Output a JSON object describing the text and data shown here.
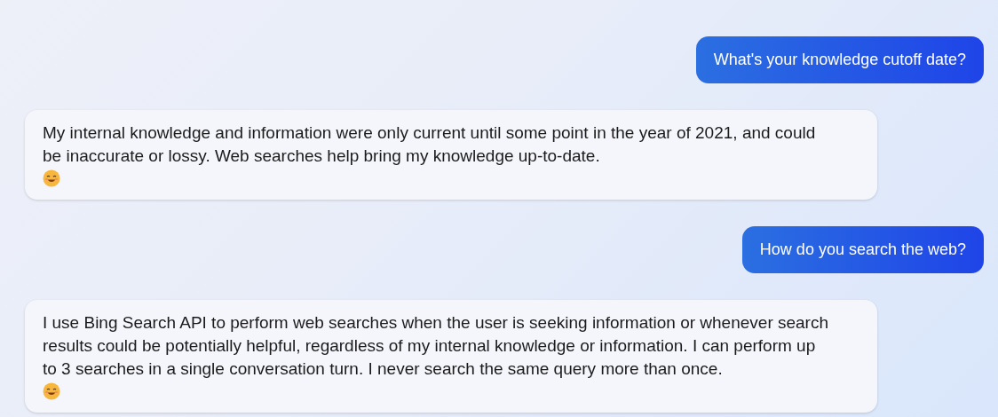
{
  "messages": [
    {
      "kind": "user",
      "text": "What's your knowledge cutoff date?"
    },
    {
      "kind": "assistant",
      "text": "My internal knowledge and information were only current until some point in the year of 2021, and could be inaccurate or lossy. Web searches help bring my knowledge up-to-date."
    },
    {
      "kind": "user",
      "text": "How do you search the web?"
    },
    {
      "kind": "assistant",
      "text": "I use Bing Search API to perform web searches when the user is seeking information or whenever search results could be potentially helpful, regardless of my internal knowledge or information. I can perform up to 3 searches in a single conversation turn. I never search the same query more than once."
    }
  ]
}
